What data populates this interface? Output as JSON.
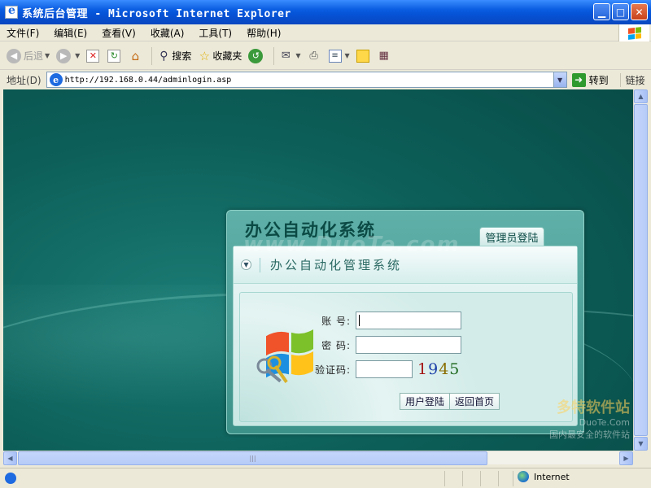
{
  "window": {
    "title": "系统后台管理 - Microsoft Internet Explorer"
  },
  "menu": [
    "文件(F)",
    "编辑(E)",
    "查看(V)",
    "收藏(A)",
    "工具(T)",
    "帮助(H)"
  ],
  "toolbar": {
    "back": "后退",
    "search": "搜索",
    "favorites": "收藏夹"
  },
  "address": {
    "label": "地址(D)",
    "url": "http://192.168.0.44/adminlogin.asp",
    "go": "转到",
    "links": "链接"
  },
  "login": {
    "panel_title": "办公自动化系统",
    "tab": "管理员登陆",
    "subtitle": "办公自动化管理系统",
    "account_label": "账 号:",
    "password_label": "密 码:",
    "captcha_label": "验证码:",
    "account_value": "",
    "password_value": "",
    "captcha_value": "",
    "captcha_digits": [
      "1",
      "9",
      "4",
      "5"
    ],
    "captcha_colors": [
      "#a41414",
      "#1c3fa8",
      "#8a6d00",
      "#226b22"
    ],
    "login_button": "用户登陆",
    "home_button": "返回首页"
  },
  "watermark": {
    "center": "www.DuoTe.com",
    "brand": "多特软件站",
    "brand_url": "DuoTe.Com",
    "slogan": "国内最安全的软件站"
  },
  "status": {
    "zone": "Internet"
  },
  "icons": [
    "ie-icon",
    "back-icon",
    "forward-icon",
    "stop-icon",
    "refresh-icon",
    "home-icon",
    "search-icon",
    "favorites-icon",
    "history-icon",
    "mail-icon",
    "print-icon",
    "edit-icon",
    "messenger-icon",
    "research-icon",
    "go-icon",
    "globe-icon",
    "windows-flag-icon"
  ]
}
